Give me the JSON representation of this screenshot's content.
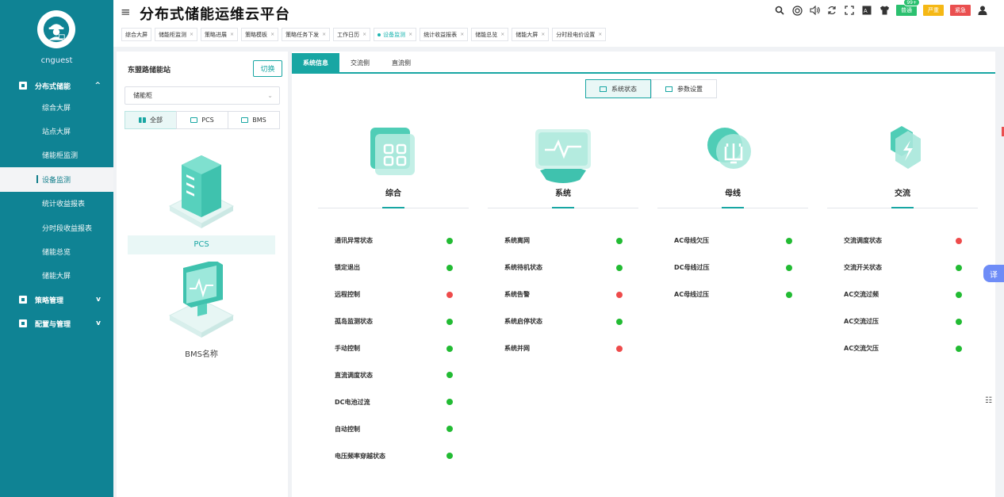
{
  "app": {
    "title": "分布式储能运维云平台"
  },
  "user": {
    "name": "cnguest"
  },
  "sidebar": {
    "groups": [
      {
        "label": "分布式储能",
        "chevron": "^",
        "icon": "energy-icon",
        "items": [
          "综合大屏",
          "站点大屏",
          "储能柜监测",
          "设备监测",
          "统计收益报表",
          "分时段收益报表",
          "储能总览",
          "储能大屏"
        ]
      },
      {
        "label": "策略管理",
        "chevron": "v",
        "icon": "strategy-icon"
      },
      {
        "label": "配置与管理",
        "chevron": "v",
        "icon": "config-icon"
      }
    ]
  },
  "header": {
    "badges": {
      "normal": "普通",
      "count": "99+",
      "serious": "严重",
      "urgent": "紧急"
    },
    "tabs": [
      {
        "label": "综合大屏",
        "close": ""
      },
      {
        "label": "储能柜监测",
        "close": "×"
      },
      {
        "label": "策略进展",
        "close": "×"
      },
      {
        "label": "策略模板",
        "close": "×"
      },
      {
        "label": "策略任务下发",
        "close": "×"
      },
      {
        "label": "工作日历",
        "close": "×"
      },
      {
        "label": "设备监测",
        "close": "×"
      },
      {
        "label": "统计收益报表",
        "close": "×"
      },
      {
        "label": "储能总览",
        "close": "×"
      },
      {
        "label": "储能大屏",
        "close": "×"
      },
      {
        "label": "分时段电价设置",
        "close": "×"
      }
    ]
  },
  "left": {
    "station": "东盟路储能站",
    "switch_label": "切换",
    "select_value": "储能柜",
    "filters": [
      "全部",
      "PCS",
      "BMS"
    ],
    "devices": [
      "PCS",
      "BMS名称"
    ]
  },
  "main": {
    "tabs": [
      "系统信息",
      "交流侧",
      "直流侧"
    ],
    "toggle": [
      "系统状态",
      "参数设置"
    ],
    "translate": "译",
    "categories": [
      {
        "title": "综合",
        "items": [
          {
            "label": "通讯异常状态",
            "status": "green"
          },
          {
            "label": "锁定退出",
            "status": "green"
          },
          {
            "label": "远程控制",
            "status": "red"
          },
          {
            "label": "孤岛监测状态",
            "status": "green"
          },
          {
            "label": "手动控制",
            "status": "green"
          },
          {
            "label": "直流调度状态",
            "status": "green"
          },
          {
            "label": "DC电池过流",
            "status": "green"
          },
          {
            "label": "自动控制",
            "status": "green"
          },
          {
            "label": "电压频率穿越状态",
            "status": "green"
          }
        ]
      },
      {
        "title": "系统",
        "items": [
          {
            "label": "系统离网",
            "status": "green"
          },
          {
            "label": "系统待机状态",
            "status": "green"
          },
          {
            "label": "系统告警",
            "status": "red"
          },
          {
            "label": "系统启停状态",
            "status": "green"
          },
          {
            "label": "系统并网",
            "status": "red"
          }
        ]
      },
      {
        "title": "母线",
        "items": [
          {
            "label": "AC母线欠压",
            "status": "green"
          },
          {
            "label": "DC母线过压",
            "status": "green"
          },
          {
            "label": "AC母线过压",
            "status": "green"
          }
        ]
      },
      {
        "title": "交流",
        "items": [
          {
            "label": "交流调度状态",
            "status": "red"
          },
          {
            "label": "交流开关状态",
            "status": "green"
          },
          {
            "label": "AC交流过频",
            "status": "green"
          },
          {
            "label": "AC交流过压",
            "status": "green"
          },
          {
            "label": "AC交流欠压",
            "status": "green"
          }
        ]
      }
    ]
  }
}
